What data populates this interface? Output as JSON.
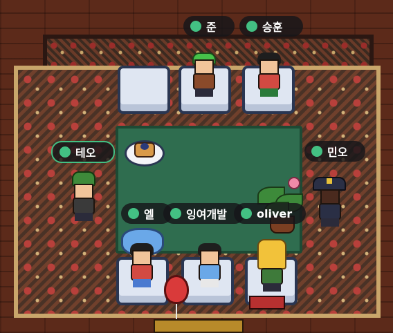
{
  "players": [
    {
      "id": "jun",
      "name": "준",
      "status": "online",
      "selected": false
    },
    {
      "id": "seunghun",
      "name": "승훈",
      "status": "online",
      "selected": false
    },
    {
      "id": "teo",
      "name": "테오",
      "status": "online",
      "selected": true
    },
    {
      "id": "mino",
      "name": "민오",
      "status": "online",
      "selected": false
    },
    {
      "id": "el",
      "name": "엘",
      "status": "online",
      "selected": false
    },
    {
      "id": "ingyeo",
      "name": "잉여개발",
      "status": "online",
      "selected": false
    },
    {
      "id": "oliver",
      "name": "oliver",
      "status": "online",
      "selected": false
    }
  ],
  "colors": {
    "status_online": "#43c083",
    "tag_background": "#16161a",
    "table_felt": "#2f6d4f",
    "floor": "#5c2a1a"
  }
}
